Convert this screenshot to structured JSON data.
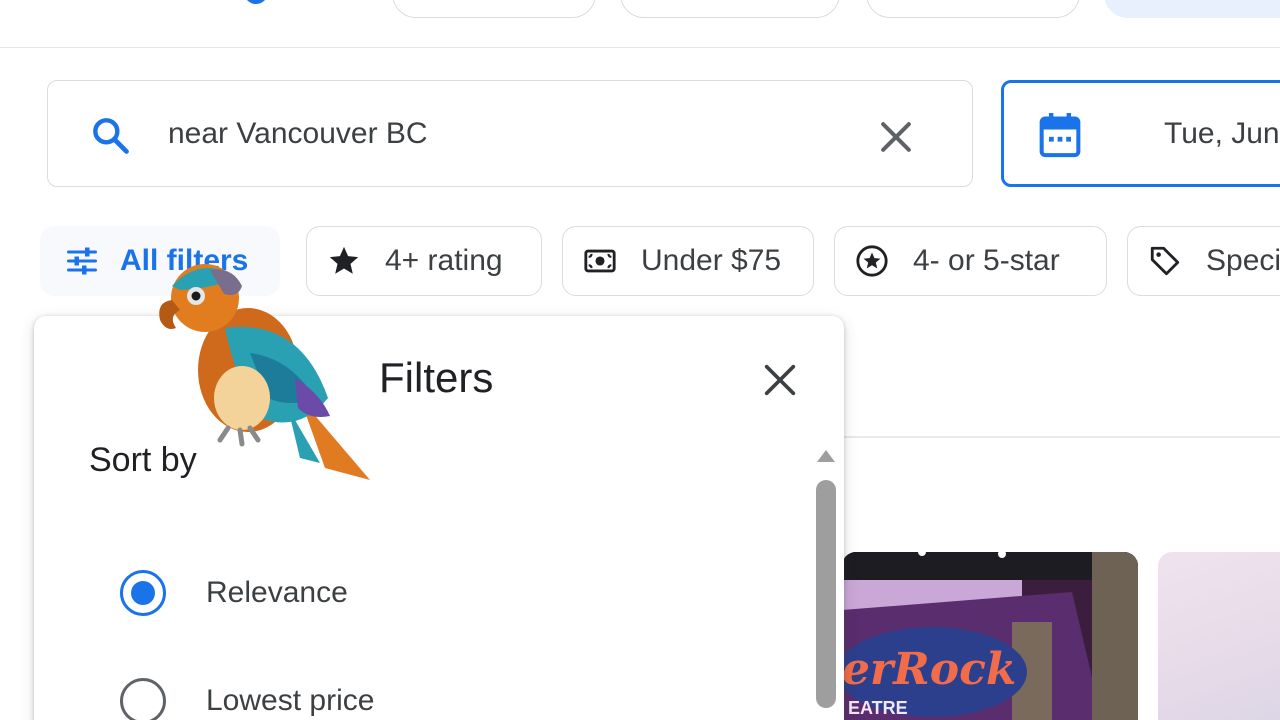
{
  "colors": {
    "accent": "#1a73e8",
    "text": "#3c4043",
    "border": "#dadce0"
  },
  "search": {
    "query": "near Vancouver BC",
    "icon": "search-icon",
    "clear_icon": "close-icon"
  },
  "date": {
    "value": "Tue, Jun",
    "icon": "calendar-icon"
  },
  "filter_bar": {
    "all_filters": "All filters",
    "chips": [
      {
        "label": "4+ rating",
        "icon": "star-icon"
      },
      {
        "label": "Under $75",
        "icon": "money-icon"
      },
      {
        "label": "4- or 5-star",
        "icon": "star-circle-icon"
      },
      {
        "label": "Speci",
        "icon": "tag-icon"
      }
    ]
  },
  "filters_panel": {
    "title": "Filters",
    "sort_by": "Sort by",
    "options": [
      {
        "label": "Relevance",
        "selected": true
      },
      {
        "label": "Lowest price",
        "selected": false
      }
    ]
  },
  "thumbnail": {
    "sign_text": "erRock",
    "sign_sub": "EATRE"
  }
}
